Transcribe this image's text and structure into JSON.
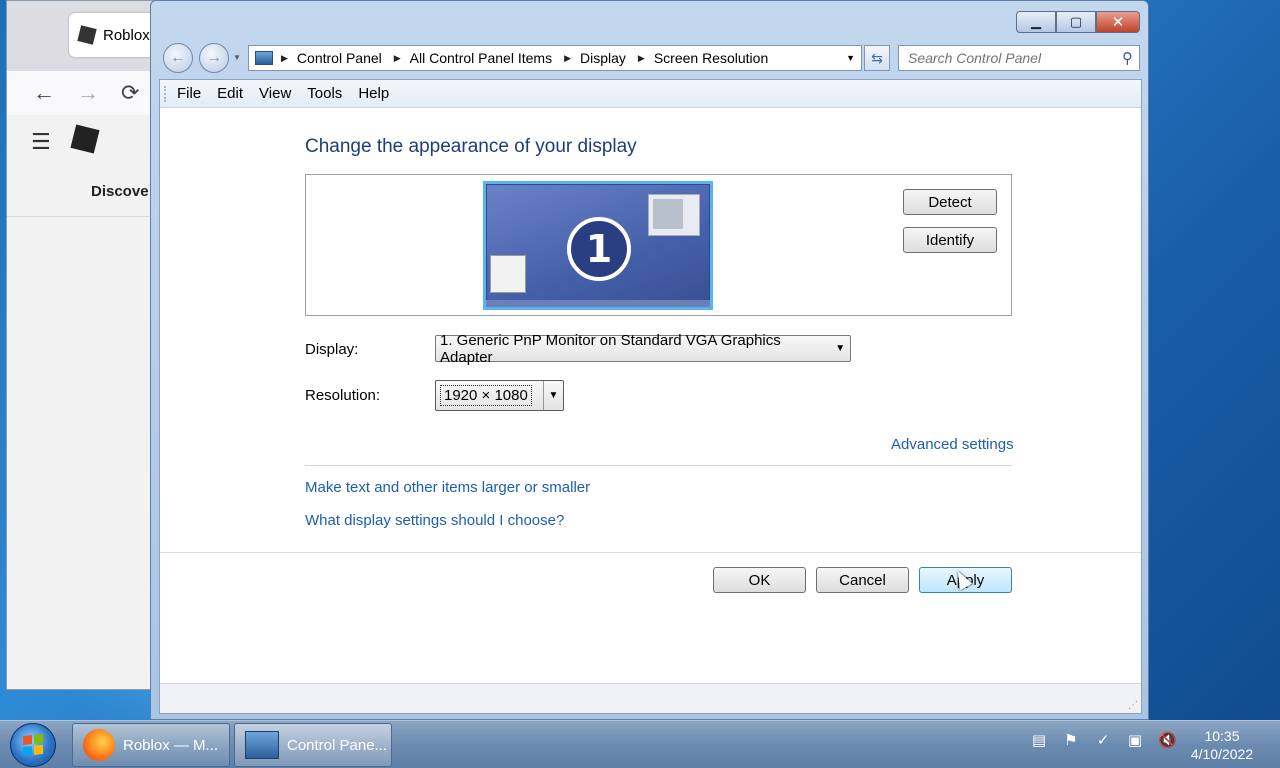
{
  "browser": {
    "tab_title": "Roblox",
    "nav_section": "Discove"
  },
  "window": {
    "breadcrumbs": [
      "Control Panel",
      "All Control Panel Items",
      "Display",
      "Screen Resolution"
    ],
    "search_placeholder": "Search Control Panel",
    "menu": [
      "File",
      "Edit",
      "View",
      "Tools",
      "Help"
    ],
    "heading": "Change the appearance of your display",
    "monitor_number": "1",
    "detect_label": "Detect",
    "identify_label": "Identify",
    "display_label": "Display:",
    "display_value": "1. Generic PnP Monitor on Standard VGA Graphics Adapter",
    "resolution_label": "Resolution:",
    "resolution_value": "1920 × 1080",
    "advanced_link": "Advanced settings",
    "text_size_link": "Make text and other items larger or smaller",
    "help_link": "What display settings should I choose?",
    "ok_label": "OK",
    "cancel_label": "Cancel",
    "apply_label": "Apply"
  },
  "taskbar": {
    "firefox_label": "Roblox — M...",
    "controlpanel_label": "Control Pane...",
    "time": "10:35",
    "date": "4/10/2022"
  }
}
